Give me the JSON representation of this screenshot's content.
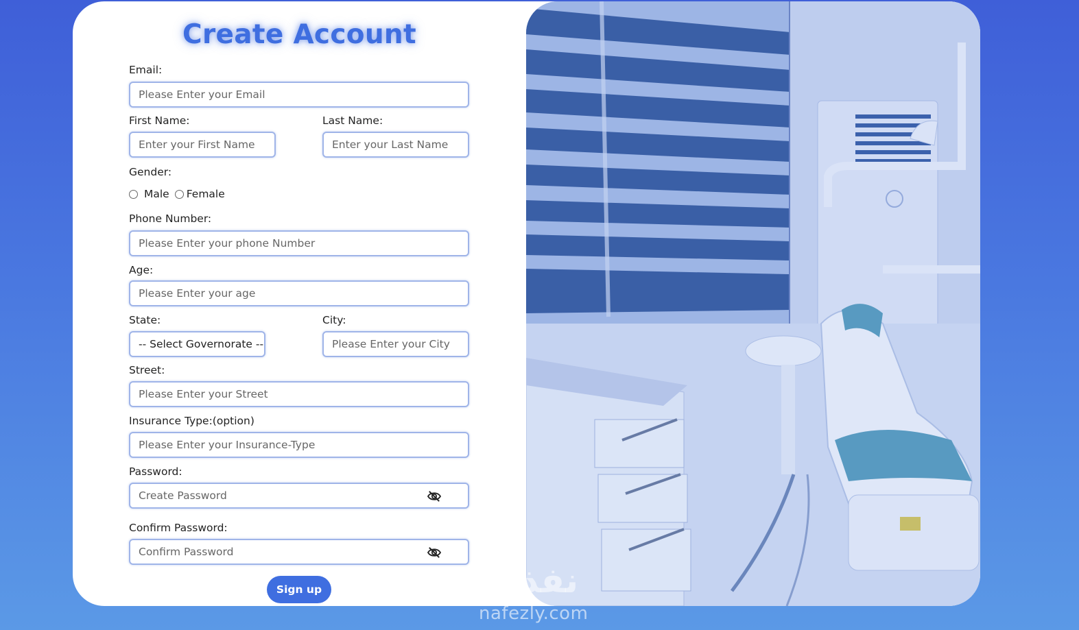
{
  "form": {
    "title": "Create Account",
    "email": {
      "label": "Email:",
      "placeholder": "Please Enter your Email"
    },
    "first_name": {
      "label": "First Name:",
      "placeholder": "Enter your First Name"
    },
    "last_name": {
      "label": "Last Name:",
      "placeholder": "Enter your Last Name"
    },
    "gender": {
      "label": "Gender:",
      "options": [
        "Male",
        "Female"
      ]
    },
    "phone": {
      "label": "Phone Number:",
      "placeholder": "Please Enter your phone Number"
    },
    "age": {
      "label": "Age:",
      "placeholder": "Please Enter your age"
    },
    "state": {
      "label": "State:",
      "selected": "-- Select Governorate --"
    },
    "city": {
      "label": "City:",
      "placeholder": "Please Enter your City"
    },
    "street": {
      "label": "Street:",
      "placeholder": "Please Enter your Street"
    },
    "insurance": {
      "label": "Insurance Type:(option)",
      "placeholder": "Please Enter your Insurance-Type"
    },
    "password": {
      "label": "Password:",
      "placeholder": "Create Password",
      "icon": "eye-slash-icon"
    },
    "confirm_password": {
      "label": "Confirm Password:",
      "placeholder": "Confirm Password",
      "icon": "eye-slash-icon"
    },
    "submit_label": "Sign up"
  },
  "watermark": {
    "logo_text": "نفذلي",
    "url": "nafezly.com"
  },
  "colors": {
    "accent": "#3f6ee0",
    "field_border": "#9fb4e8",
    "background_top": "#3f5fd8",
    "background_bottom": "#5b99e6"
  }
}
